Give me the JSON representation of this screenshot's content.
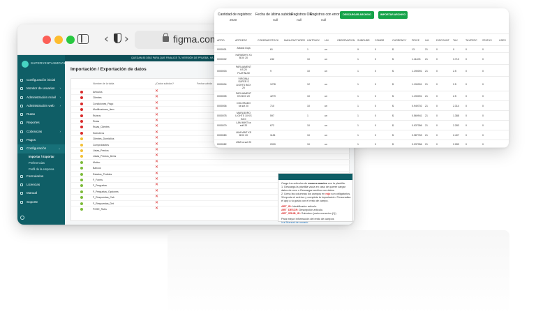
{
  "browser": {
    "url": "figma.com"
  },
  "app": {
    "brand": "SUPERVENTASMOVIL",
    "banner": "QUEDAN 85 DÍAS PARA QUE FINALICE TU VERSIÓN DE PRUEBA. HA",
    "page_title": "Importación / Exportación de datos",
    "menu": [
      {
        "label": "Configuración inicial",
        "icon": "gear-icon",
        "chevron": ""
      },
      {
        "label": "Monitor de usuarios",
        "icon": "user-icon",
        "chevron": "›"
      },
      {
        "label": "Administración móvil",
        "icon": "phone-icon",
        "chevron": "›"
      },
      {
        "label": "Administración web",
        "icon": "monitor-icon",
        "chevron": "›"
      },
      {
        "label": "Rutas",
        "icon": "route-icon",
        "chevron": ""
      },
      {
        "label": "Reportes",
        "icon": "report-icon",
        "chevron": ""
      },
      {
        "label": "Cobranzas",
        "icon": "money-icon",
        "chevron": "›"
      },
      {
        "label": "Pagos",
        "icon": "card-icon",
        "chevron": ""
      },
      {
        "label": "Configuración",
        "icon": "settings-icon",
        "chevron": "⌄"
      }
    ],
    "submenu": [
      {
        "label": "Importar / Exportar"
      },
      {
        "label": "Preferencias"
      },
      {
        "label": "Perfil de la empresa"
      }
    ],
    "menu_after": [
      {
        "label": "Formularios",
        "icon": "form-icon"
      },
      {
        "label": "Licencias",
        "icon": "license-icon"
      },
      {
        "label": "Manual",
        "icon": "book-icon"
      },
      {
        "label": "Soporte",
        "icon": "support-icon"
      }
    ],
    "table_headers": {
      "name": "Nombre de la tabla",
      "uploaded": "¿Datos subidos?",
      "date": "Fecha subida"
    },
    "tables": [
      {
        "name": "Artículos",
        "status": "#d92b2b"
      },
      {
        "name": "Clientes",
        "status": "#d92b2b"
      },
      {
        "name": "Condiciones_Pago",
        "status": "#d92b2b"
      },
      {
        "name": "Modificadores_Item",
        "status": "#d92b2b"
      },
      {
        "name": "Rubros",
        "status": "#d92b2b"
      },
      {
        "name": "Rutas",
        "status": "#d92b2b"
      },
      {
        "name": "Rutas_Clientes",
        "status": "#d92b2b"
      },
      {
        "name": "Subrubros",
        "status": "#d92b2b"
      },
      {
        "name": "Clientes_Domicilios",
        "status": "#f2c037"
      },
      {
        "name": "Comprobantes",
        "status": "#f2c037"
      },
      {
        "name": "Listas_Precios",
        "status": "#f2c037"
      },
      {
        "name": "Listas_Precios_Items",
        "status": "#f2c037"
      },
      {
        "name": "Motivo",
        "status": "#7dbb3a"
      },
      {
        "name": "Bancos",
        "status": "#7dbb3a"
      },
      {
        "name": "Estados_Pedidos",
        "status": "#7dbb3a"
      },
      {
        "name": "F_Forms",
        "status": "#7dbb3a"
      },
      {
        "name": "F_Preguntas",
        "status": "#7dbb3a"
      },
      {
        "name": "F_Preguntas_Opciones",
        "status": "#7dbb3a"
      },
      {
        "name": "F_Respuestas_Cab",
        "status": "#7dbb3a"
      },
      {
        "name": "F_Respuestas_Det",
        "status": "#7dbb3a"
      },
      {
        "name": "POSE_Rubs",
        "status": "#7dbb3a"
      }
    ],
    "x_mark": "✕",
    "help": {
      "intro_a": "Carga tus artículos de ",
      "intro_b": "manera masiva",
      "intro_c": " con la plantilla.",
      "step1": "1. Descarga la plantilla vacía en caso de querer cargar datos de cero o Descargar archivo con datos.",
      "step2a": "2. Llena las columnas los campos en ",
      "step2b": "rojo",
      "step2c": " son obligatorios.",
      "step3": "3.Importa el archivo y completa la importación. Personaliza el app a tu gusto con el resto de campo.",
      "f1a": "ART_ID:",
      "f1b": " Identificador artículo.",
      "f2a": "ART_DESCR:",
      "f2b": " Descripción artículo.",
      "f3a": "ART_SRUB_ID:",
      "f3b": " Subrubro (valor numerico (1))",
      "more": "Para mayor información del resto de campos",
      "link": "ir al Manual de usuario"
    }
  },
  "front": {
    "stats": [
      {
        "label": "Cantidad de registros:",
        "value": "2020"
      },
      {
        "label": "Fecha de última subida:",
        "value": "null"
      },
      {
        "label": "Registros OK:",
        "value": "null"
      },
      {
        "label": "Registros con error:",
        "value": "null"
      }
    ],
    "buttons": {
      "download": "DESCARGAR ARCHIVO",
      "import": "IMPORTAR ARCHIVO"
    },
    "columns": [
      "ARTID",
      "ARTDESC",
      "CODEBAR",
      "STOCK",
      "MANUFACTURER",
      "UNITPACK",
      "UM",
      "OBSERVATION",
      "SUBRUBR",
      "COMBR",
      "CURRENCY",
      "PRICE",
      "IVA",
      "DISCOUNT",
      "TAX",
      "TAXPERC",
      "STATUS",
      "USES"
    ],
    "rows": [
      {
        "id": "0000001",
        "desc": "Aleado Doja",
        "stock": "61",
        "unit": "1",
        "um": "un",
        "sub": "9",
        "comb": "0",
        "cur": "$",
        "price": "13",
        "iva": "21",
        "disc": "0",
        "tax": "0",
        "taxp": "0",
        "status": "0"
      },
      {
        "id": "0000002",
        "desc": "HARMONY X3 BOX 20",
        "stock": "242",
        "unit": "10",
        "um": "un",
        "sub": "1",
        "comb": "0",
        "cur": "$",
        "price": "1.11403",
        "iva": "21",
        "disc": "0",
        "tax": "3.713",
        "taxp": "0",
        "status": "0"
      },
      {
        "id": "0000003",
        "desc": "PARLIAMENT KS 20 PLATINUM",
        "stock": "9",
        "unit": "10",
        "um": "un",
        "sub": "1",
        "comb": "0",
        "cur": "$",
        "price": "1.190091",
        "iva": "21",
        "disc": "0",
        "tax": "2.5",
        "taxp": "0",
        "status": "0"
      },
      {
        "id": "0000004",
        "desc": "VIRGINIA SUPER S LIGHTS BOX 20",
        "stock": "1278",
        "unit": "12",
        "um": "un",
        "sub": "1",
        "comb": "0",
        "cur": "$",
        "price": "1.190091",
        "iva": "21",
        "disc": "0",
        "tax": "2.5",
        "taxp": "0",
        "status": "0"
      },
      {
        "id": "0000005",
        "desc": "PARLIAMENT KS BOX 20",
        "stock": "4279",
        "unit": "10",
        "um": "un",
        "sub": "1",
        "comb": "0",
        "cur": "$",
        "price": "1.190091",
        "iva": "21",
        "disc": "0",
        "tax": "2.5",
        "taxp": "0",
        "status": "0"
      },
      {
        "id": "0000006",
        "desc": "COLORADO ks sof 20",
        "stock": "710",
        "unit": "10",
        "um": "un",
        "sub": "1",
        "comb": "0",
        "cur": "$",
        "price": "0.949702",
        "iva": "21",
        "disc": "0",
        "tax": "2.314",
        "taxp": "0",
        "status": "0"
      },
      {
        "id": "0000078",
        "desc": "MARLBORO LIGHTS 10 KS BOX",
        "stock": "597",
        "unit": "1",
        "um": "un",
        "sub": "1",
        "comb": "0",
        "cur": "$",
        "price": "0.569941",
        "iva": "21",
        "disc": "0",
        "tax": "1.388",
        "taxp": "0",
        "status": "0"
      },
      {
        "id": "0000079",
        "desc": "L&M MINT ks soft 20",
        "stock": "672",
        "unit": "10",
        "um": "un",
        "sub": "1",
        "comb": "0",
        "cur": "$",
        "price": "0.937056",
        "iva": "21",
        "disc": "0",
        "tax": "2.283",
        "taxp": "0",
        "status": "0"
      },
      {
        "id": "0000080",
        "desc": "L&M MINT KS BOX 20",
        "stock": "1181",
        "unit": "10",
        "um": "un",
        "sub": "1",
        "comb": "0",
        "cur": "$",
        "price": "0.987763",
        "iva": "21",
        "disc": "0",
        "tax": "2.407",
        "taxp": "0",
        "status": "0"
      },
      {
        "id": "0000082",
        "desc": "LSM ks sof 20",
        "stock": "2099",
        "unit": "10",
        "um": "un",
        "sub": "1",
        "comb": "0",
        "cur": "$",
        "price": "0.937056",
        "iva": "21",
        "disc": "0",
        "tax": "2.283",
        "taxp": "0",
        "status": "0"
      }
    ]
  }
}
